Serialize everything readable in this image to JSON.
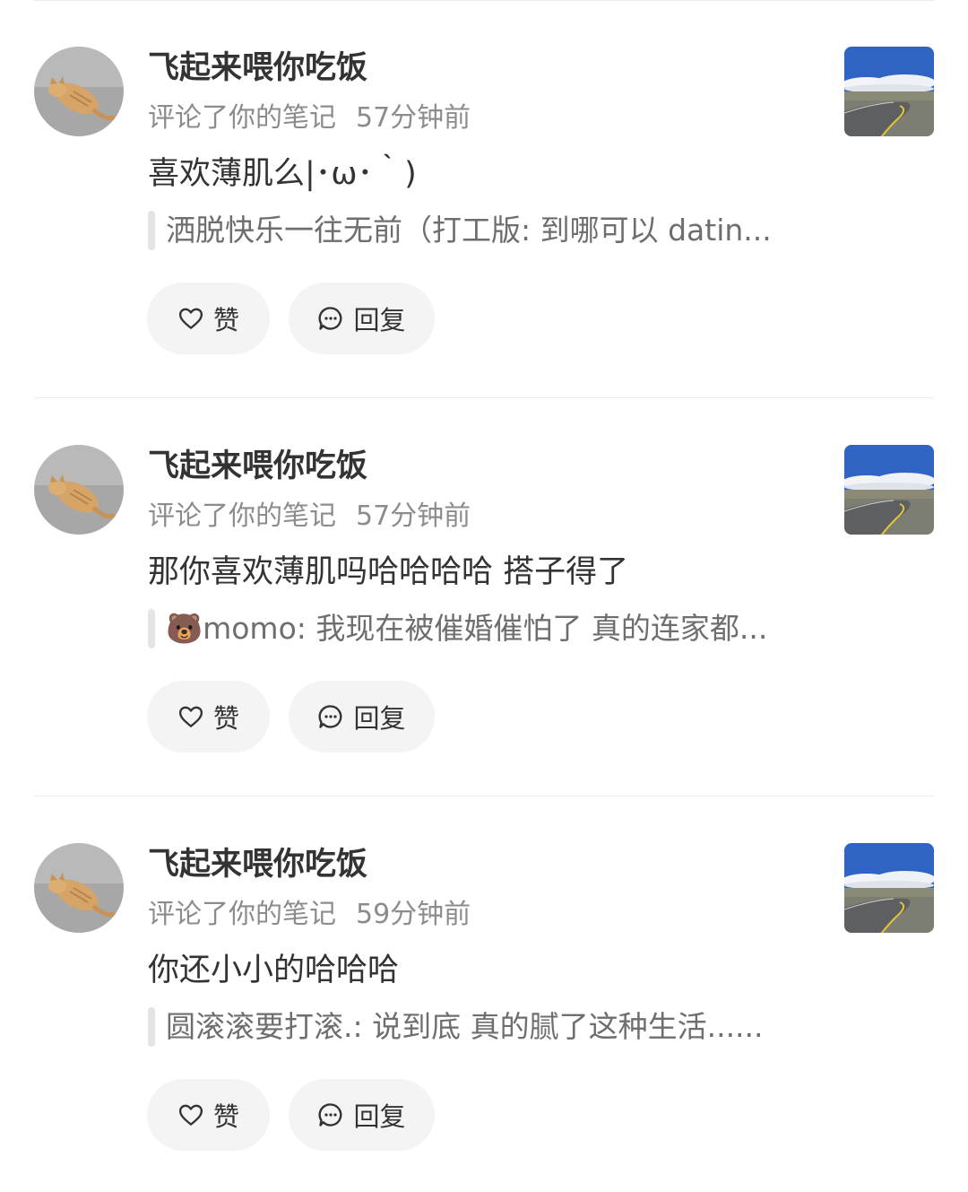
{
  "notifications": [
    {
      "username": "飞起来喂你吃饭",
      "action": "评论了你的笔记",
      "time": "57分钟前",
      "comment": "喜欢薄肌么|･ω･｀)",
      "quote": "洒脱快乐一往无前（打工版: 到哪可以 datin...",
      "like_label": "赞",
      "reply_label": "回复"
    },
    {
      "username": "飞起来喂你吃饭",
      "action": "评论了你的笔记",
      "time": "57分钟前",
      "comment": "那你喜欢薄肌吗哈哈哈哈 搭子得了",
      "quote": "🐻momo: 我现在被催婚催怕了 真的连家都...",
      "like_label": "赞",
      "reply_label": "回复"
    },
    {
      "username": "飞起来喂你吃饭",
      "action": "评论了你的笔记",
      "time": "59分钟前",
      "comment": "你还小小的哈哈哈",
      "quote": "圆滚滚要打滚.: 说到底 真的腻了这种生活......",
      "like_label": "赞",
      "reply_label": "回复"
    }
  ],
  "icons": {
    "like": "heart-outline-icon",
    "reply": "chat-bubble-icon"
  },
  "colors": {
    "text_primary": "#333333",
    "text_secondary": "#8c8c8c",
    "button_bg": "#f4f4f4",
    "divider": "#ececec"
  }
}
